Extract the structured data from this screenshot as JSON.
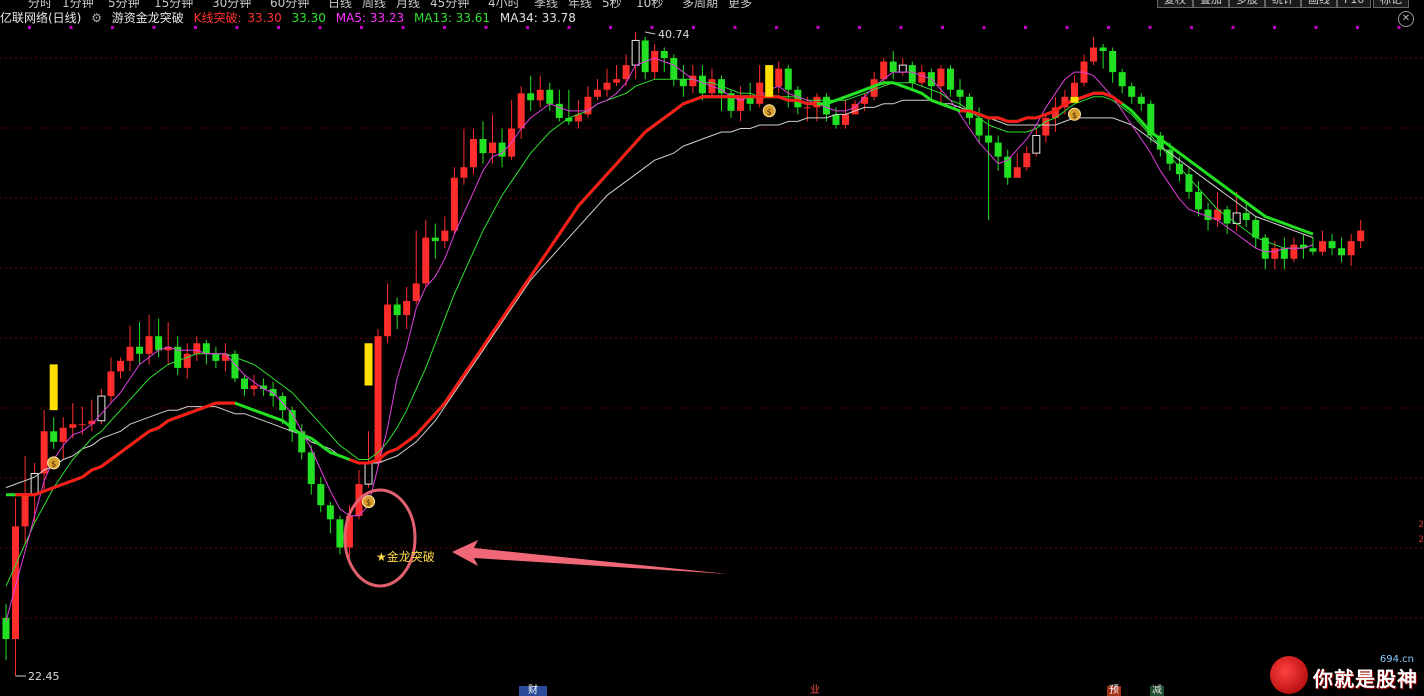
{
  "toolbar": {
    "left_items": [
      "分时",
      "1分钟",
      "5分钟",
      "15分钟",
      "30分钟",
      "60分钟",
      "日线",
      "周线",
      "月线",
      "45分钟",
      "4小时",
      "季线",
      "年线",
      "5秒",
      "10秒",
      "多周期",
      "更多"
    ],
    "right_buttons": [
      "复权",
      "叠加",
      "多股",
      "统计",
      "画线",
      "F10",
      "标记"
    ]
  },
  "legend": {
    "source": "亿联网络(日线)",
    "indicator": "游资金龙突破",
    "kline_label": "K线突破:",
    "kline_value": "33.30",
    "close_value": "33.30",
    "ma5": "MA5: 33.23",
    "ma13": "MA13: 33.61",
    "ma34": "MA34: 33.78"
  },
  "annotations": {
    "high_label": "40.74",
    "low_label": "22.45",
    "signal_label": "金龙突破"
  },
  "events": [
    "财",
    "业",
    "预",
    "减"
  ],
  "watermark": {
    "text": "你就是股神",
    "domain": "694.cn"
  },
  "colors": {
    "up": "#ff2c2c",
    "down": "#22e022",
    "ma5": "#e040e0",
    "ma13": "#30e030",
    "ma34": "#d0d0d0",
    "trend_up": "#ff1a1a",
    "trend_down": "#22e022",
    "signal": "#ffe000"
  },
  "chart_data": {
    "type": "candlestick",
    "title": "亿联网络(日线)",
    "ylim": [
      22.45,
      40.74
    ],
    "annotations": [
      {
        "label": "40.74",
        "kind": "high",
        "index": 67
      },
      {
        "label": "22.45",
        "kind": "low",
        "index": 1
      },
      {
        "label": "金龙突破",
        "kind": "signal",
        "index": 39
      }
    ],
    "candles": [
      [
        24.1,
        23.5,
        24.5,
        22.9
      ],
      [
        23.5,
        26.7,
        27.5,
        22.45
      ],
      [
        26.7,
        27.6,
        28.7,
        26.2
      ],
      [
        27.6,
        28.2,
        28.5,
        26.8
      ],
      [
        28.2,
        29.4,
        30.0,
        27.7
      ],
      [
        29.4,
        29.1,
        29.8,
        28.9
      ],
      [
        29.1,
        29.5,
        29.8,
        28.6
      ],
      [
        29.5,
        29.6,
        30.2,
        29.2
      ],
      [
        29.6,
        29.6,
        30.1,
        29.3
      ],
      [
        29.6,
        29.7,
        30.3,
        29.4
      ],
      [
        29.7,
        30.4,
        30.6,
        29.6
      ],
      [
        30.4,
        31.1,
        31.5,
        30.2
      ],
      [
        31.1,
        31.4,
        31.5,
        30.9
      ],
      [
        31.4,
        31.8,
        32.4,
        31.1
      ],
      [
        31.8,
        31.6,
        32.5,
        31.3
      ],
      [
        31.6,
        32.1,
        32.7,
        31.3
      ],
      [
        32.1,
        31.7,
        32.6,
        31.5
      ],
      [
        31.7,
        31.8,
        32.5,
        31.3
      ],
      [
        31.8,
        31.2,
        32.1,
        31.0
      ],
      [
        31.2,
        31.6,
        31.9,
        30.9
      ],
      [
        31.6,
        31.9,
        32.1,
        31.4
      ],
      [
        31.9,
        31.6,
        32.0,
        31.3
      ],
      [
        31.6,
        31.4,
        31.8,
        31.2
      ],
      [
        31.4,
        31.6,
        31.9,
        31.1
      ],
      [
        31.6,
        30.9,
        31.7,
        30.8
      ],
      [
        30.9,
        30.6,
        31.0,
        30.4
      ],
      [
        30.6,
        30.7,
        31.0,
        30.4
      ],
      [
        30.7,
        30.6,
        30.9,
        30.4
      ],
      [
        30.6,
        30.4,
        30.8,
        30.1
      ],
      [
        30.4,
        30.0,
        30.5,
        29.6
      ],
      [
        30.0,
        29.4,
        30.1,
        29.1
      ],
      [
        29.4,
        28.8,
        29.6,
        28.6
      ],
      [
        28.8,
        27.9,
        29.0,
        27.6
      ],
      [
        27.9,
        27.3,
        28.1,
        27.1
      ],
      [
        27.3,
        26.9,
        27.4,
        26.5
      ],
      [
        26.9,
        26.1,
        27.0,
        25.9
      ],
      [
        26.1,
        27.0,
        27.3,
        25.8
      ],
      [
        27.0,
        27.9,
        28.3,
        26.9
      ],
      [
        27.9,
        28.5,
        29.4,
        27.8
      ],
      [
        28.5,
        32.1,
        32.3,
        28.4
      ],
      [
        32.1,
        33.0,
        33.6,
        31.9
      ],
      [
        33.0,
        32.7,
        33.2,
        32.3
      ],
      [
        32.7,
        33.1,
        33.5,
        32.3
      ],
      [
        33.1,
        33.6,
        35.1,
        33.0
      ],
      [
        33.6,
        34.9,
        35.4,
        33.5
      ],
      [
        34.9,
        34.8,
        35.3,
        34.3
      ],
      [
        34.8,
        35.1,
        35.5,
        34.6
      ],
      [
        35.1,
        36.6,
        36.9,
        35.0
      ],
      [
        36.6,
        36.9,
        38.0,
        36.4
      ],
      [
        36.9,
        37.7,
        38.0,
        36.7
      ],
      [
        37.7,
        37.3,
        38.2,
        37.0
      ],
      [
        37.3,
        37.6,
        38.4,
        37.0
      ],
      [
        37.6,
        37.2,
        38.0,
        36.9
      ],
      [
        37.2,
        38.0,
        38.8,
        37.1
      ],
      [
        38.0,
        39.0,
        39.2,
        37.7
      ],
      [
        39.0,
        38.8,
        39.5,
        38.5
      ],
      [
        38.8,
        39.1,
        39.5,
        38.6
      ],
      [
        39.1,
        38.7,
        39.3,
        38.5
      ],
      [
        38.7,
        38.3,
        39.1,
        38.2
      ],
      [
        38.3,
        38.2,
        39.1,
        38.1
      ],
      [
        38.2,
        38.4,
        38.8,
        38.0
      ],
      [
        38.4,
        38.9,
        39.2,
        38.3
      ],
      [
        38.9,
        39.1,
        39.4,
        38.8
      ],
      [
        39.1,
        39.3,
        39.7,
        38.9
      ],
      [
        39.3,
        39.4,
        39.8,
        39.2
      ],
      [
        39.4,
        39.8,
        40.1,
        39.2
      ],
      [
        39.8,
        40.5,
        40.74,
        39.4
      ],
      [
        40.5,
        39.6,
        40.6,
        39.4
      ],
      [
        39.6,
        40.2,
        40.4,
        39.4
      ],
      [
        40.2,
        40.0,
        40.3,
        39.6
      ],
      [
        40.0,
        39.4,
        40.1,
        39.2
      ],
      [
        39.4,
        39.2,
        39.8,
        38.9
      ],
      [
        39.2,
        39.5,
        39.8,
        39.0
      ],
      [
        39.5,
        39.0,
        39.8,
        38.8
      ],
      [
        39.0,
        39.4,
        39.7,
        38.9
      ],
      [
        39.4,
        39.0,
        39.5,
        38.5
      ],
      [
        39.0,
        38.5,
        39.1,
        38.3
      ],
      [
        38.5,
        38.9,
        39.2,
        38.2
      ],
      [
        38.9,
        38.7,
        39.3,
        38.5
      ],
      [
        38.7,
        39.3,
        39.8,
        38.6
      ],
      [
        39.3,
        39.2,
        39.6,
        38.9
      ],
      [
        39.2,
        39.7,
        39.9,
        39.0
      ],
      [
        39.7,
        39.1,
        39.8,
        38.6
      ],
      [
        39.1,
        38.6,
        39.2,
        38.4
      ],
      [
        38.6,
        38.6,
        38.9,
        38.2
      ],
      [
        38.6,
        38.9,
        39.0,
        38.2
      ],
      [
        38.9,
        38.4,
        39.0,
        38.2
      ],
      [
        38.4,
        38.1,
        38.6,
        38.0
      ],
      [
        38.1,
        38.4,
        38.8,
        38.0
      ],
      [
        38.4,
        38.7,
        38.8,
        38.4
      ],
      [
        38.7,
        38.9,
        39.0,
        38.5
      ],
      [
        38.9,
        39.4,
        39.6,
        38.8
      ],
      [
        39.4,
        39.9,
        40.0,
        39.2
      ],
      [
        39.9,
        39.6,
        40.2,
        39.4
      ],
      [
        39.6,
        39.8,
        40.0,
        39.5
      ],
      [
        39.8,
        39.3,
        39.9,
        39.1
      ],
      [
        39.3,
        39.6,
        39.8,
        39.2
      ],
      [
        39.6,
        39.2,
        39.7,
        38.8
      ],
      [
        39.2,
        39.7,
        39.8,
        38.7
      ],
      [
        39.7,
        39.1,
        39.8,
        38.9
      ],
      [
        39.1,
        38.9,
        39.4,
        38.6
      ],
      [
        38.9,
        38.3,
        39.0,
        38.1
      ],
      [
        38.3,
        37.8,
        38.6,
        37.6
      ],
      [
        37.8,
        37.6,
        38.3,
        35.4
      ],
      [
        37.6,
        37.2,
        37.8,
        36.8
      ],
      [
        37.2,
        36.6,
        37.4,
        36.4
      ],
      [
        36.6,
        36.9,
        37.3,
        36.6
      ],
      [
        36.9,
        37.3,
        37.5,
        36.8
      ],
      [
        37.3,
        37.8,
        38.0,
        37.2
      ],
      [
        37.8,
        38.3,
        38.4,
        37.6
      ],
      [
        38.3,
        38.6,
        38.9,
        37.9
      ],
      [
        38.6,
        38.9,
        39.1,
        38.4
      ],
      [
        38.9,
        39.3,
        39.5,
        38.8
      ],
      [
        39.3,
        39.9,
        40.1,
        39.2
      ],
      [
        39.9,
        40.3,
        40.6,
        39.8
      ],
      [
        40.3,
        40.2,
        40.4,
        39.7
      ],
      [
        40.2,
        39.6,
        40.3,
        39.3
      ],
      [
        39.6,
        39.2,
        39.7,
        39.0
      ],
      [
        39.2,
        38.9,
        39.3,
        38.7
      ],
      [
        38.9,
        38.7,
        39.0,
        38.5
      ],
      [
        38.7,
        37.8,
        38.8,
        37.6
      ],
      [
        37.8,
        37.4,
        37.9,
        37.2
      ],
      [
        37.4,
        37.0,
        37.6,
        36.8
      ],
      [
        37.0,
        36.7,
        37.2,
        36.5
      ],
      [
        36.7,
        36.2,
        36.9,
        36.0
      ],
      [
        36.2,
        35.7,
        36.5,
        35.5
      ],
      [
        35.7,
        35.4,
        35.9,
        35.1
      ],
      [
        35.4,
        35.7,
        36.2,
        35.2
      ],
      [
        35.7,
        35.3,
        35.8,
        35.0
      ],
      [
        35.3,
        35.6,
        36.2,
        35.1
      ],
      [
        35.6,
        35.4,
        35.9,
        35.2
      ],
      [
        35.4,
        34.9,
        35.5,
        34.6
      ],
      [
        34.9,
        34.3,
        35.0,
        34.0
      ],
      [
        34.3,
        34.6,
        34.8,
        34.0
      ],
      [
        34.6,
        34.3,
        34.9,
        34.0
      ],
      [
        34.3,
        34.7,
        34.9,
        34.2
      ],
      [
        34.7,
        34.6,
        35.0,
        34.3
      ],
      [
        34.6,
        34.5,
        34.9,
        34.4
      ],
      [
        34.5,
        34.8,
        35.1,
        34.4
      ],
      [
        34.8,
        34.6,
        35.0,
        34.4
      ],
      [
        34.6,
        34.4,
        34.9,
        34.2
      ],
      [
        34.4,
        34.8,
        35.0,
        34.1
      ],
      [
        34.8,
        35.1,
        35.4,
        34.6
      ]
    ],
    "trend_line": [
      27.6,
      27.6,
      27.6,
      27.6,
      27.7,
      27.8,
      27.9,
      28.0,
      28.1,
      28.3,
      28.4,
      28.6,
      28.8,
      29.0,
      29.2,
      29.4,
      29.5,
      29.7,
      29.8,
      29.9,
      30.0,
      30.1,
      30.2,
      30.2,
      30.2,
      30.1,
      30.0,
      29.9,
      29.8,
      29.7,
      29.5,
      29.3,
      29.2,
      29.0,
      28.8,
      28.7,
      28.6,
      28.5,
      28.5,
      28.6,
      28.8,
      28.9,
      29.1,
      29.3,
      29.6,
      29.9,
      30.2,
      30.6,
      31.0,
      31.4,
      31.8,
      32.2,
      32.6,
      33.0,
      33.4,
      33.8,
      34.2,
      34.6,
      35.0,
      35.4,
      35.8,
      36.1,
      36.4,
      36.7,
      37.0,
      37.3,
      37.6,
      37.9,
      38.1,
      38.3,
      38.5,
      38.7,
      38.8,
      38.9,
      38.9,
      38.9,
      38.9,
      38.9,
      38.9,
      38.9,
      38.9,
      38.9,
      38.8,
      38.8,
      38.7,
      38.7,
      38.7,
      38.8,
      38.9,
      39.0,
      39.1,
      39.2,
      39.3,
      39.3,
      39.2,
      39.1,
      39.0,
      38.8,
      38.7,
      38.6,
      38.5,
      38.5,
      38.4,
      38.3,
      38.3,
      38.2,
      38.2,
      38.3,
      38.3,
      38.4,
      38.5,
      38.7,
      38.8,
      38.9,
      39.0,
      39.0,
      38.9,
      38.7,
      38.5,
      38.2,
      37.9,
      37.7,
      37.5,
      37.3,
      37.1,
      36.9,
      36.7,
      36.5,
      36.3,
      36.1,
      35.9,
      35.7,
      35.5,
      35.4,
      35.3,
      35.2,
      35.1,
      35.0
    ],
    "trend_up_segments": [
      [
        1,
        24
      ],
      [
        36,
        85
      ],
      [
        100,
        117
      ]
    ],
    "ma5": [
      24.0,
      25.0,
      26.0,
      27.0,
      28.0,
      28.6,
      29.0,
      29.3,
      29.4,
      29.6,
      29.9,
      30.2,
      30.5,
      30.9,
      31.3,
      31.5,
      31.7,
      31.8,
      31.7,
      31.7,
      31.7,
      31.6,
      31.6,
      31.6,
      31.3,
      31.0,
      30.8,
      30.6,
      30.5,
      30.2,
      29.9,
      29.4,
      28.9,
      28.3,
      27.7,
      27.2,
      27.0,
      27.0,
      27.3,
      28.4,
      29.5,
      30.9,
      31.8,
      32.9,
      33.5,
      33.8,
      34.3,
      35.0,
      35.6,
      36.2,
      36.8,
      37.2,
      37.3,
      37.6,
      38.0,
      38.3,
      38.5,
      38.7,
      38.6,
      38.5,
      38.5,
      38.5,
      38.7,
      38.8,
      39.0,
      39.3,
      39.8,
      39.9,
      40.0,
      39.9,
      39.8,
      39.6,
      39.4,
      39.3,
      39.2,
      39.1,
      38.9,
      38.8,
      38.9,
      38.9,
      39.1,
      39.2,
      39.0,
      38.9,
      38.8,
      38.7,
      38.6,
      38.5,
      38.5,
      38.6,
      38.9,
      39.2,
      39.4,
      39.6,
      39.6,
      39.6,
      39.5,
      39.4,
      39.1,
      38.8,
      38.4,
      38.0,
      37.6,
      37.3,
      37.0,
      37.1,
      37.4,
      37.7,
      38.1,
      38.6,
      39.0,
      39.4,
      39.6,
      39.6,
      39.5,
      39.2,
      38.9,
      38.5,
      38.1,
      37.7,
      37.3,
      36.8,
      36.4,
      36.0,
      35.7,
      35.6,
      35.5,
      35.4,
      35.2,
      35.0,
      34.8,
      34.6,
      34.5,
      34.5,
      34.6,
      34.6,
      34.6,
      34.7
    ],
    "ma13": [
      25.0,
      25.6,
      26.2,
      26.8,
      27.3,
      27.8,
      28.2,
      28.6,
      28.9,
      29.2,
      29.4,
      29.7,
      30.0,
      30.3,
      30.6,
      30.9,
      31.1,
      31.3,
      31.4,
      31.5,
      31.6,
      31.6,
      31.6,
      31.6,
      31.5,
      31.4,
      31.3,
      31.1,
      30.9,
      30.7,
      30.5,
      30.2,
      29.9,
      29.6,
      29.3,
      29.0,
      28.8,
      28.6,
      28.6,
      28.8,
      29.1,
      29.5,
      30.0,
      30.6,
      31.2,
      31.9,
      32.6,
      33.3,
      33.9,
      34.5,
      35.1,
      35.6,
      36.1,
      36.5,
      36.9,
      37.3,
      37.6,
      37.9,
      38.1,
      38.3,
      38.4,
      38.5,
      38.7,
      38.8,
      38.9,
      39.0,
      39.2,
      39.3,
      39.4,
      39.4,
      39.4,
      39.4,
      39.4,
      39.3,
      39.3,
      39.2,
      39.1,
      39.0,
      39.0,
      38.9,
      38.9,
      38.9,
      38.9,
      38.9,
      38.8,
      38.8,
      38.8,
      38.8,
      38.8,
      38.9,
      39.0,
      39.1,
      39.2,
      39.3,
      39.3,
      39.3,
      39.2,
      39.1,
      39.0,
      38.8,
      38.7,
      38.5,
      38.3,
      38.1,
      38.0,
      37.9,
      37.9,
      37.9,
      38.0,
      38.2,
      38.3,
      38.5,
      38.7,
      38.8,
      38.9,
      38.9,
      38.8,
      38.6,
      38.4,
      38.1,
      37.8,
      37.5,
      37.2,
      36.9,
      36.6,
      36.3,
      36.0,
      35.7,
      35.5,
      35.3,
      35.1,
      34.9,
      34.8,
      34.7,
      34.6,
      34.6,
      34.6,
      34.7
    ],
    "ma34": [
      27.8,
      27.9,
      28.0,
      28.1,
      28.3,
      28.4,
      28.6,
      28.7,
      28.9,
      29.0,
      29.2,
      29.3,
      29.4,
      29.6,
      29.7,
      29.8,
      29.9,
      30.0,
      30.0,
      30.1,
      30.1,
      30.1,
      30.1,
      30.0,
      29.9,
      29.9,
      29.8,
      29.7,
      29.6,
      29.5,
      29.4,
      29.3,
      29.1,
      29.0,
      28.9,
      28.7,
      28.6,
      28.5,
      28.5,
      28.5,
      28.6,
      28.7,
      28.9,
      29.1,
      29.4,
      29.7,
      30.1,
      30.5,
      30.9,
      31.3,
      31.7,
      32.1,
      32.5,
      32.9,
      33.3,
      33.7,
      34.0,
      34.3,
      34.6,
      34.9,
      35.2,
      35.5,
      35.8,
      36.1,
      36.3,
      36.5,
      36.7,
      36.9,
      37.1,
      37.2,
      37.3,
      37.5,
      37.6,
      37.7,
      37.8,
      37.9,
      37.9,
      38.0,
      38.0,
      38.1,
      38.1,
      38.1,
      38.2,
      38.2,
      38.3,
      38.3,
      38.3,
      38.4,
      38.4,
      38.5,
      38.6,
      38.6,
      38.7,
      38.7,
      38.8,
      38.8,
      38.8,
      38.8,
      38.7,
      38.7,
      38.6,
      38.5,
      38.4,
      38.3,
      38.2,
      38.1,
      38.1,
      38.1,
      38.1,
      38.1,
      38.1,
      38.2,
      38.3,
      38.3,
      38.3,
      38.3,
      38.3,
      38.2,
      38.1,
      37.9,
      37.7,
      37.5,
      37.3,
      37.1,
      36.9,
      36.7,
      36.5,
      36.3,
      36.1,
      35.9,
      35.7,
      35.5,
      35.4,
      35.3,
      35.2,
      35.1,
      35.0,
      34.9
    ],
    "signal_bars": [
      [
        5,
        30.0,
        31.3
      ],
      [
        38,
        30.7,
        31.9
      ],
      [
        80,
        38.9,
        39.8
      ],
      [
        112,
        38.8,
        38.9
      ]
    ],
    "money_bag_indices": [
      5,
      38,
      80,
      112
    ]
  }
}
